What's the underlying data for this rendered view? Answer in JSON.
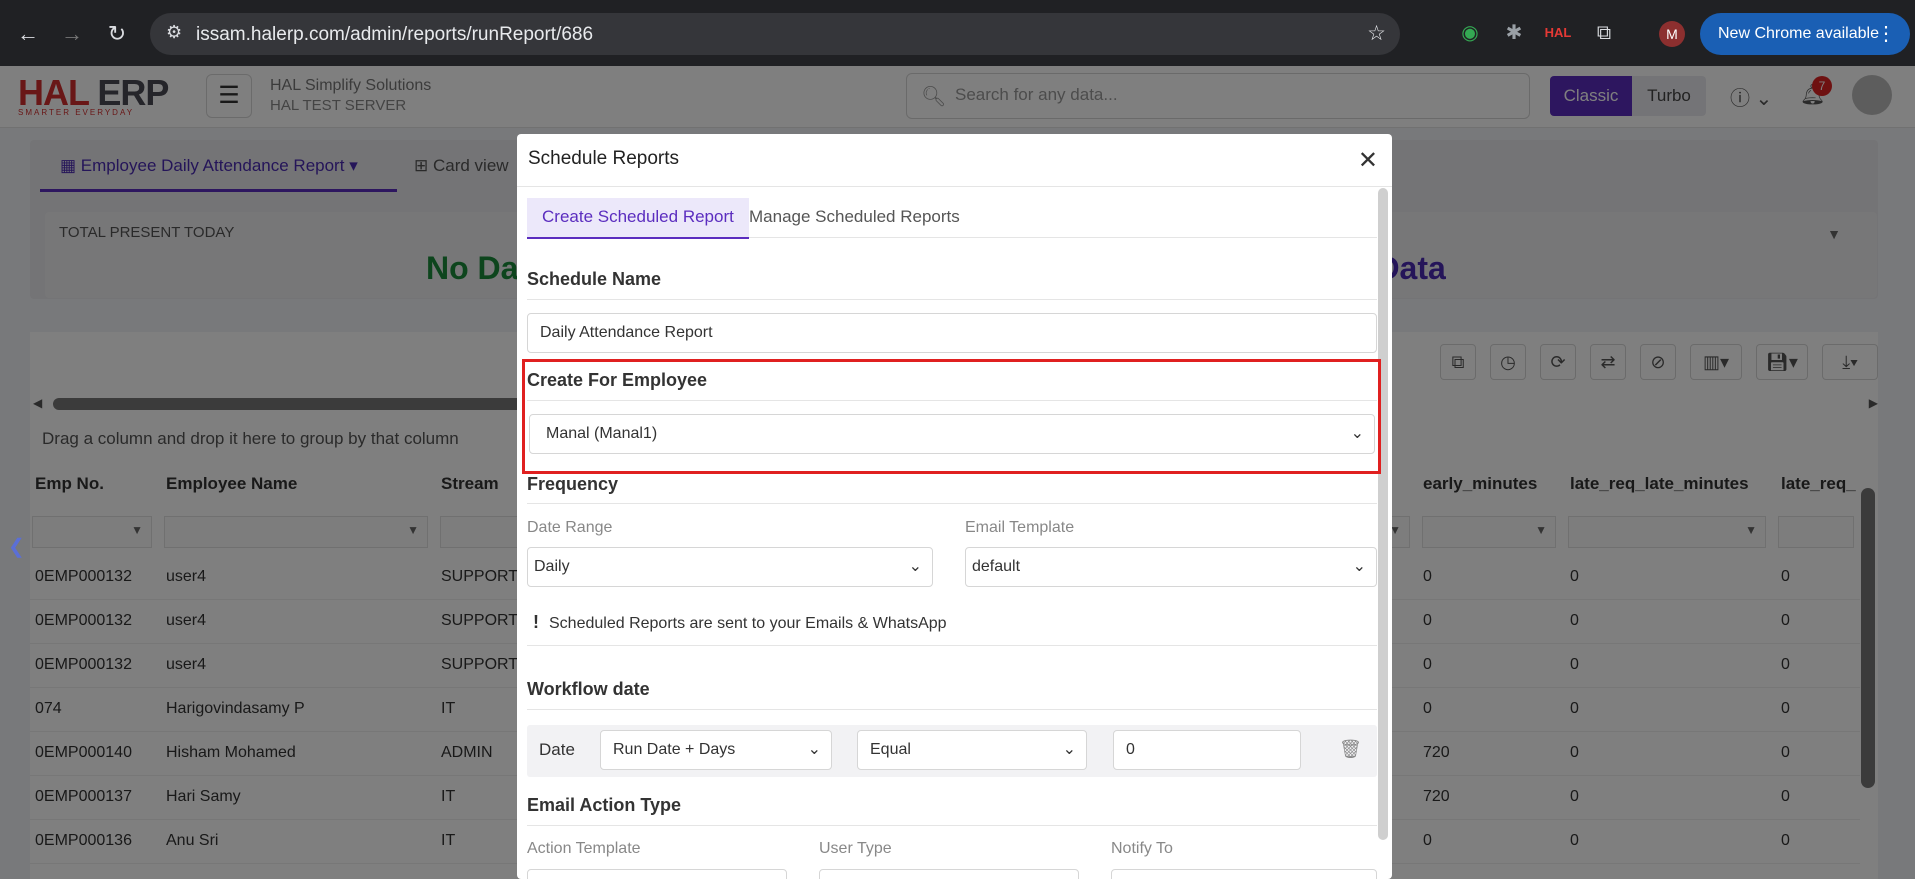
{
  "browser": {
    "url": "issam.halerp.com/admin/reports/runReport/686",
    "new_chrome_label": "New Chrome available",
    "profile_initial": "M",
    "ext_hal_label": "HAL"
  },
  "app": {
    "logo_hal": "HAL",
    "logo_erp": "ERP",
    "logo_tagline": "SMARTER EVERYDAY",
    "company_name": "HAL Simplify Solutions",
    "server_name": "HAL TEST SERVER",
    "search_placeholder": "Search for any data...",
    "mode_classic": "Classic",
    "mode_turbo": "Turbo",
    "notification_count": "7"
  },
  "report": {
    "tab_active": "Employee Daily Attendance Report",
    "tab_card": "Card view",
    "present_label": "TOTAL PRESENT TODAY",
    "no_data_left": "No Da",
    "no_data_right": "o Data",
    "group_hint": "Drag a column and drop it here to group by that column",
    "columns": [
      "Emp No.",
      "Employee Name",
      "Stream",
      "early_minutes",
      "late_req_late_minutes",
      "late_req_"
    ],
    "rows": [
      [
        "0EMP000132",
        "user4",
        "SUPPORTS",
        "0",
        "0",
        "0"
      ],
      [
        "0EMP000132",
        "user4",
        "SUPPORTS",
        "0",
        "0",
        "0"
      ],
      [
        "0EMP000132",
        "user4",
        "SUPPORTS",
        "0",
        "0",
        "0"
      ],
      [
        "074",
        "Harigovindasamy P",
        "IT",
        "0",
        "0",
        "0"
      ],
      [
        "0EMP000140",
        "Hisham Mohamed",
        "ADMIN",
        "720",
        "0",
        "0"
      ],
      [
        "0EMP000137",
        "Hari Samy",
        "IT",
        "720",
        "0",
        "0"
      ],
      [
        "0EMP000136",
        "Anu Sri",
        "IT",
        "0",
        "0",
        "0"
      ]
    ]
  },
  "modal": {
    "title": "Schedule Reports",
    "tab_create": "Create Scheduled Report",
    "tab_manage": "Manage Scheduled Reports",
    "schedule_name_label": "Schedule Name",
    "schedule_name_value": "Daily Attendance Report",
    "create_for_label": "Create For Employee",
    "create_for_value": "Manal (Manal1)",
    "frequency_label": "Frequency",
    "date_range_label": "Date Range",
    "date_range_value": "Daily",
    "email_template_label": "Email Template",
    "email_template_value": "default",
    "note": "Scheduled Reports are sent to your Emails & WhatsApp",
    "workflow_label": "Workflow date",
    "wf_date_label": "Date",
    "wf_base_value": "Run Date + Days",
    "wf_operator_value": "Equal",
    "wf_days_value": "0",
    "email_action_label": "Email Action Type",
    "action_template_label": "Action Template",
    "user_type_label": "User Type",
    "notify_to_label": "Notify To"
  }
}
